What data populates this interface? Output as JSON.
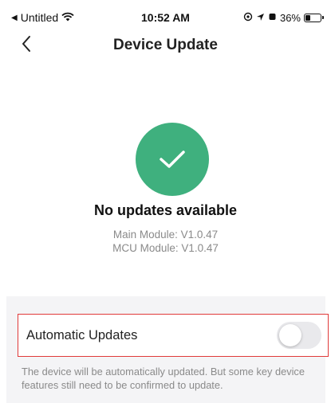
{
  "status_bar": {
    "carrier": "Untitled",
    "time": "10:52 AM",
    "battery_percent": "36%",
    "battery_level": 0.36,
    "icons": [
      "back-arrow-icon",
      "wifi-icon",
      "location-icon",
      "alarm-icon",
      "battery-icon"
    ]
  },
  "nav": {
    "title": "Device Update",
    "back_icon": "chevron-left-icon"
  },
  "update_status": {
    "icon": "checkmark-icon",
    "icon_color": "#3fb07e",
    "title": "No updates available",
    "main_module": "Main Module: V1.0.47",
    "mcu_module": "MCU Module: V1.0.47"
  },
  "settings": {
    "auto_updates_label": "Automatic Updates",
    "auto_updates_enabled": false,
    "description": "The device will be automatically updated. But some key device features still need to be confirmed to update.",
    "highlight_color": "#e03a3a"
  }
}
